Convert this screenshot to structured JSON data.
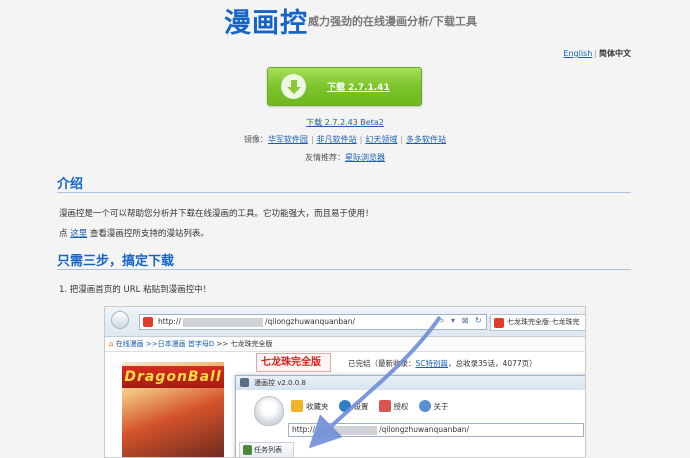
{
  "header": {
    "logo": "漫画控",
    "slogan": "威力强劲的在线漫画分析/下载工具"
  },
  "lang": {
    "english": "English",
    "sep": "|",
    "current": "简体中文"
  },
  "download": {
    "label": "下载 2.7.1.41",
    "beta": "下载 2.7.2.43 Beta2"
  },
  "mirrors": {
    "prefix": "镜像：",
    "items": [
      "华军软件园",
      "非凡软件站",
      "幻天领域",
      "多多软件站"
    ],
    "sep": "|"
  },
  "friends": {
    "prefix": "友情推荐：",
    "link": "星际浏览器"
  },
  "intro": {
    "title": "介绍",
    "desc": "漫画控是一个可以帮助您分析并下载在线漫画的工具。它功能强大，而且易于使用！",
    "line2_prefix": "点 ",
    "line2_link": "这里",
    "line2_suffix": " 查看漫画控所支持的漫站列表。"
  },
  "steps": {
    "title": "只需三步，搞定下载",
    "step1": "1. 把漫画首页的 URL 粘贴到漫画控中！"
  },
  "screenshot": {
    "url_prefix": "http://",
    "url_suffix": "/qilongzhuwanquanban/",
    "tab_label": "七龙珠完全版-七龙珠完",
    "crumbs": {
      "home": "在线漫画",
      "c1": ">>日本漫画",
      "c2": "首字母D",
      "c3": ">>",
      "c4": "七龙珠完全版"
    },
    "cover_text": "DragonBall",
    "manga_title": "七龙珠完全版",
    "status_text": "已完结（最新收录：",
    "status_link": "SC特别篇",
    "status_suffix": "，总收录35话，4077页）",
    "app": {
      "title": "漫画控 v2.0.0.8",
      "toolbar": [
        "收藏夹",
        "设置",
        "授权",
        "关于"
      ],
      "url_prefix": "http://",
      "url_suffix": "/qilongzhuwanquanban/",
      "tasklist": "任务列表"
    }
  },
  "colors": {
    "brand": "#1565c8",
    "button_green": "#7cc42c",
    "link": "#1a5fb4"
  }
}
